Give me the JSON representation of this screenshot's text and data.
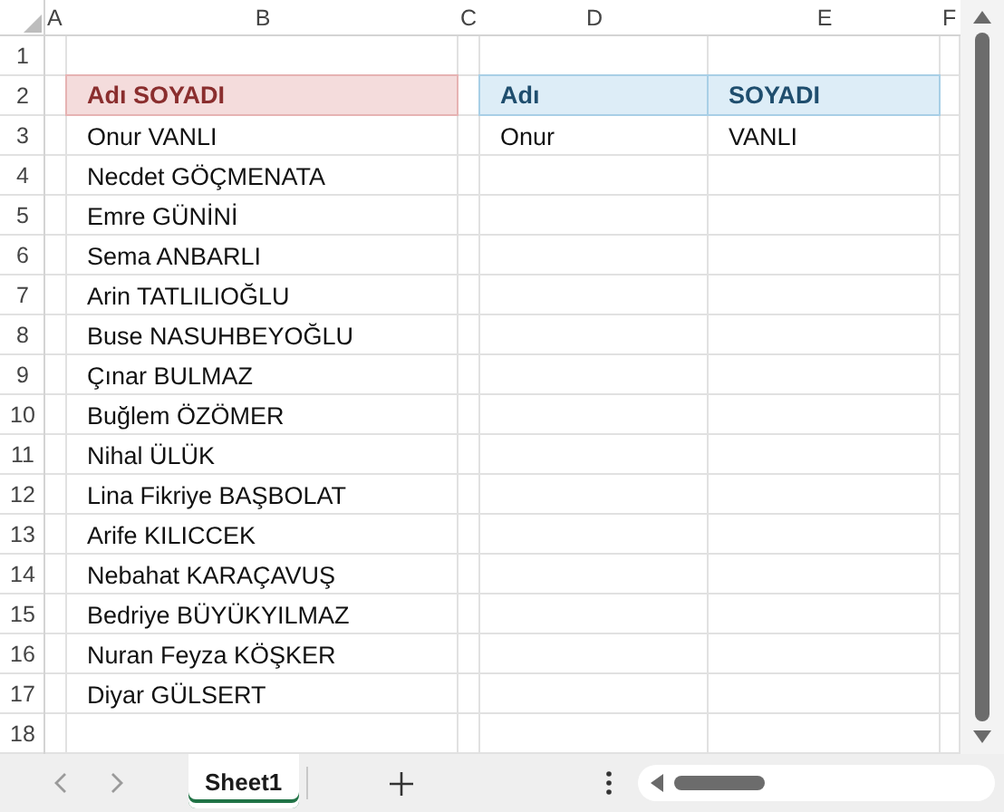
{
  "columns": [
    "A",
    "B",
    "C",
    "D",
    "E",
    "F"
  ],
  "rows": [
    {
      "number": "1"
    },
    {
      "number": "2",
      "B": {
        "text": "Adı SOYADI",
        "kind": "header",
        "color": "#f4dcdc"
      },
      "D": {
        "text": "Adı",
        "kind": "header",
        "color": "#ddedf7"
      },
      "E": {
        "text": "SOYADI",
        "kind": "header",
        "color": "#ddedf7"
      }
    },
    {
      "number": "3",
      "B": {
        "text": "Onur VANLI",
        "kind": "data"
      },
      "D": {
        "text": "Onur",
        "kind": "data"
      },
      "E": {
        "text": "VANLI",
        "kind": "data"
      }
    },
    {
      "number": "4",
      "B": {
        "text": "Necdet GÖÇMENATA",
        "kind": "data"
      }
    },
    {
      "number": "5",
      "B": {
        "text": "Emre GÜNİNİ",
        "kind": "data"
      }
    },
    {
      "number": "6",
      "B": {
        "text": "Sema ANBARLI",
        "kind": "data"
      }
    },
    {
      "number": "7",
      "B": {
        "text": "Arin TATLILIOĞLU",
        "kind": "data"
      }
    },
    {
      "number": "8",
      "B": {
        "text": "Buse NASUHBEYOĞLU",
        "kind": "data"
      }
    },
    {
      "number": "9",
      "B": {
        "text": "Çınar BULMAZ",
        "kind": "data"
      }
    },
    {
      "number": "10",
      "B": {
        "text": "Buğlem ÖZÖMER",
        "kind": "data"
      }
    },
    {
      "number": "11",
      "B": {
        "text": "Nihal ÜLÜK",
        "kind": "data"
      }
    },
    {
      "number": "12",
      "B": {
        "text": "Lina Fikriye BAŞBOLAT",
        "kind": "data"
      }
    },
    {
      "number": "13",
      "B": {
        "text": "Arife KILICCEK",
        "kind": "data"
      }
    },
    {
      "number": "14",
      "B": {
        "text": "Nebahat KARAÇAVUŞ",
        "kind": "data"
      }
    },
    {
      "number": "15",
      "B": {
        "text": "Bedriye BÜYÜKYILMAZ",
        "kind": "data"
      }
    },
    {
      "number": "16",
      "B": {
        "text": "Nuran Feyza KÖŞKER",
        "kind": "data"
      }
    },
    {
      "number": "17",
      "B": {
        "text": "Diyar GÜLSERT",
        "kind": "data"
      }
    },
    {
      "number": "18"
    }
  ],
  "sheet_tabs": [
    {
      "label": "Sheet1",
      "selected": true
    }
  ]
}
